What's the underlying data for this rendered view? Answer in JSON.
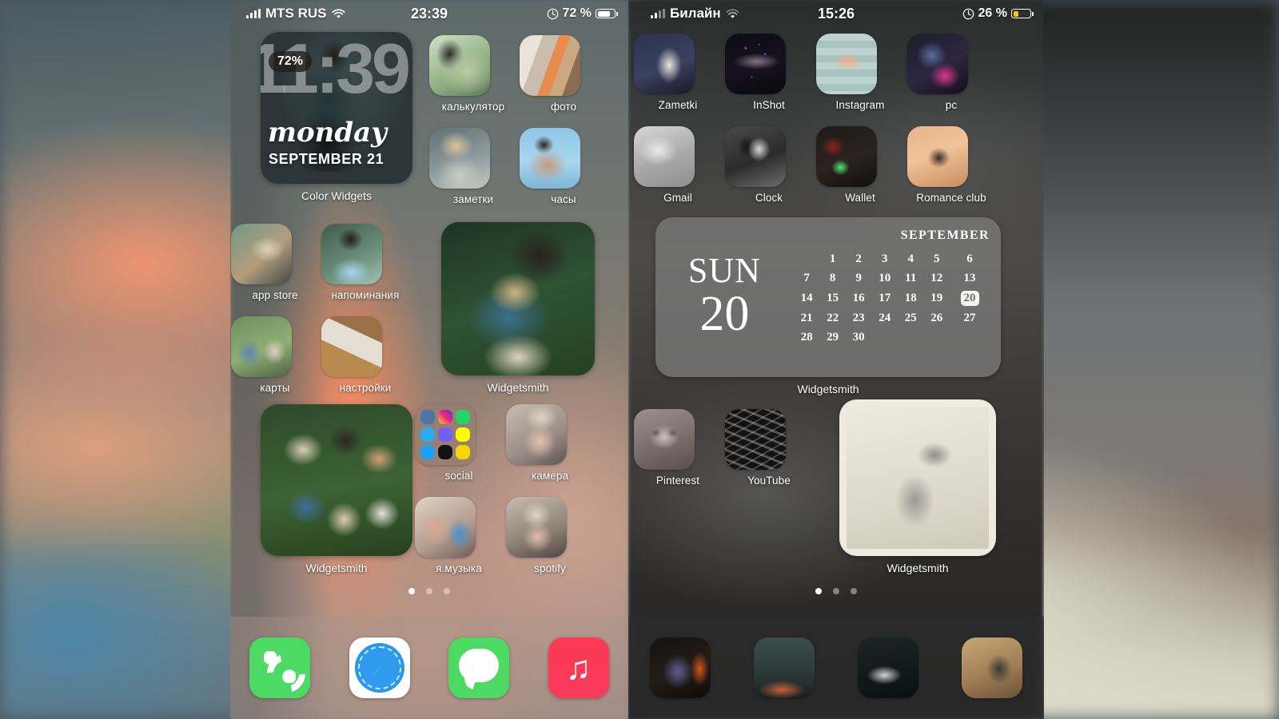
{
  "background": {
    "accent_orange": "#f78b60",
    "accent_teal": "#5d8f93",
    "dark": "#2a2c2c"
  },
  "phones": [
    {
      "id": "left",
      "status": {
        "carrier": "MTS RUS",
        "time": "23:39",
        "battery_pct": "72 %",
        "signal_icon": "cellular-bars-icon",
        "wifi_icon": "wifi-icon",
        "orientation_lock_icon": "orientation-lock-icon",
        "battery_icon": "battery-icon"
      },
      "widgets": {
        "color_widgets": {
          "label": "Color Widgets",
          "percent": "72%",
          "big_time": "11:39",
          "weekday": "monday",
          "date": "SEPTEMBER 21"
        },
        "photo_widget_top": {
          "label": "Widgetsmith"
        },
        "photo_widget_bottom": {
          "label": "Widgetsmith"
        }
      },
      "apps": [
        {
          "name": "калькулятор",
          "icon": "photo-icon-calculator"
        },
        {
          "name": "фото",
          "icon": "photo-icon-photos"
        },
        {
          "name": "заметки",
          "icon": "photo-icon-notes"
        },
        {
          "name": "часы",
          "icon": "photo-icon-clock"
        },
        {
          "name": "app store",
          "icon": "photo-icon-appstore"
        },
        {
          "name": "напоминания",
          "icon": "photo-icon-reminders"
        },
        {
          "name": "карты",
          "icon": "photo-icon-maps"
        },
        {
          "name": "настройки",
          "icon": "photo-icon-settings"
        },
        {
          "name": "social",
          "icon": "folder-icon"
        },
        {
          "name": "камера",
          "icon": "photo-icon-camera"
        },
        {
          "name": "я.музыка",
          "icon": "photo-icon-yandexmusic"
        },
        {
          "name": "spotify",
          "icon": "photo-icon-spotify"
        }
      ],
      "social_folder_apps": [
        "vk",
        "instagram",
        "whatsapp",
        "telegram",
        "viber",
        "snapchat",
        "twitter",
        "tiktok",
        "messages"
      ],
      "page_dots": {
        "count": 3,
        "active": 1
      },
      "dock": [
        {
          "name": "Phone",
          "icon": "phone-icon"
        },
        {
          "name": "Safari",
          "icon": "safari-compass-icon"
        },
        {
          "name": "Messages",
          "icon": "messages-bubble-icon"
        },
        {
          "name": "Music",
          "icon": "music-note-icon"
        }
      ]
    },
    {
      "id": "right",
      "status": {
        "carrier": "Билайн",
        "time": "15:26",
        "battery_pct": "26 %",
        "signal_icon": "cellular-bars-icon",
        "wifi_icon": "wifi-icon",
        "orientation_lock_icon": "orientation-lock-icon",
        "battery_icon": "battery-low-icon"
      },
      "apps": [
        {
          "name": "Zametki",
          "icon": "photo-icon-angel"
        },
        {
          "name": "InShot",
          "icon": "photo-icon-nosleep"
        },
        {
          "name": "Instagram",
          "icon": "photo-icon-neon"
        },
        {
          "name": "pc",
          "icon": "photo-icon-dragon"
        },
        {
          "name": "Gmail",
          "icon": "photo-icon-smoke"
        },
        {
          "name": "Clock",
          "icon": "photo-icon-man"
        },
        {
          "name": "Wallet",
          "icon": "photo-icon-dino-lamp"
        },
        {
          "name": "Romance club",
          "icon": "photo-icon-heart"
        },
        {
          "name": "Pinterest",
          "icon": "photo-icon-cat"
        },
        {
          "name": "YouTube",
          "icon": "photo-icon-dino-pattern"
        }
      ],
      "widgets": {
        "calendar": {
          "label": "Widgetsmith",
          "weekday": "SUN",
          "day": "20",
          "month": "SEPTEMBER",
          "today": 20,
          "weeks": [
            [
              "",
              "1",
              "2",
              "3",
              "4",
              "5",
              "6"
            ],
            [
              "7",
              "8",
              "9",
              "10",
              "11",
              "12",
              "13"
            ],
            [
              "14",
              "15",
              "16",
              "17",
              "18",
              "19",
              "20"
            ],
            [
              "21",
              "22",
              "23",
              "24",
              "25",
              "26",
              "27"
            ],
            [
              "28",
              "29",
              "30",
              "",
              "",
              "",
              ""
            ]
          ]
        },
        "photo_widget": {
          "label": "Widgetsmith"
        }
      },
      "page_dots": {
        "count": 3,
        "active": 1
      },
      "dock": [
        {
          "name": "dock-app-1",
          "icon": "photo-icon-dragon-head"
        },
        {
          "name": "dock-app-2",
          "icon": "photo-icon-night-sky"
        },
        {
          "name": "dock-app-3",
          "icon": "photo-icon-creature"
        },
        {
          "name": "dock-app-4",
          "icon": "photo-icon-godzilla"
        }
      ]
    }
  ]
}
